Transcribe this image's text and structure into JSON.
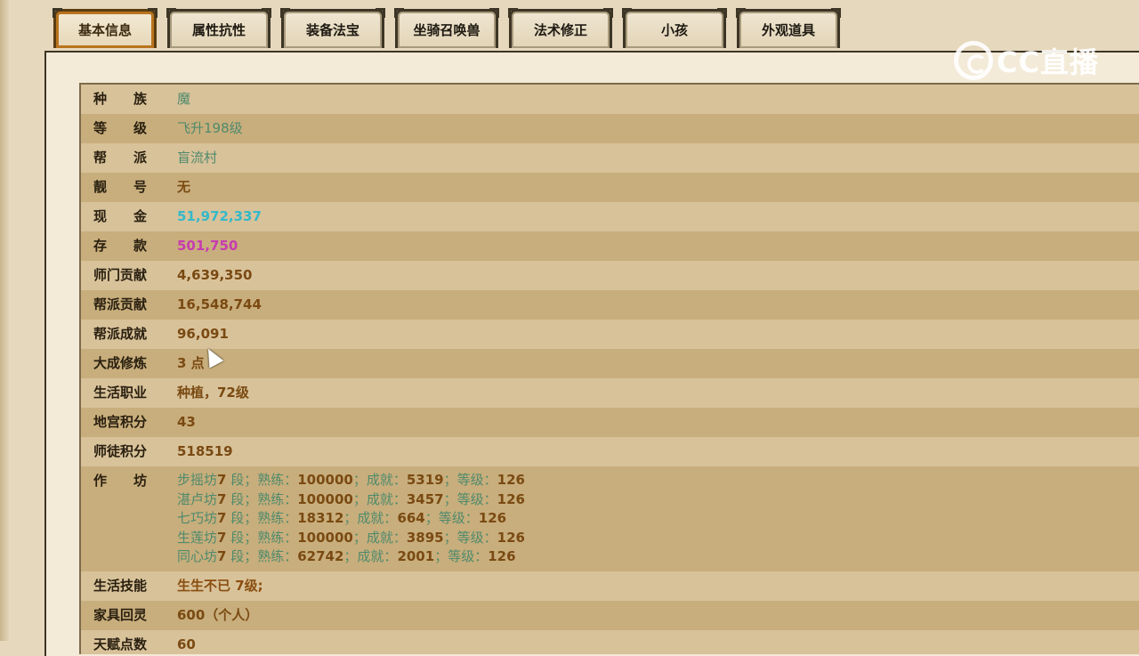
{
  "tabs": [
    {
      "label": "基本信息",
      "active": true
    },
    {
      "label": "属性抗性",
      "active": false
    },
    {
      "label": "装备法宝",
      "active": false
    },
    {
      "label": "坐骑召唤兽",
      "active": false
    },
    {
      "label": "法术修正",
      "active": false
    },
    {
      "label": "小孩",
      "active": false
    },
    {
      "label": "外观道具",
      "active": false
    }
  ],
  "logo": {
    "text": "CC直播",
    "icon": "cc-logo-icon"
  },
  "rows": [
    {
      "label": "种　　族",
      "value": "魔"
    },
    {
      "label": "等　　级",
      "value": "飞升198级"
    },
    {
      "label": "帮　　派",
      "value": "盲流村"
    },
    {
      "label": "靓　　号",
      "value": "无"
    },
    {
      "label": "现　　金",
      "value": "51,972,337"
    },
    {
      "label": "存　　款",
      "value": "501,750"
    },
    {
      "label": "师门贡献",
      "value": "4,639,350"
    },
    {
      "label": "帮派贡献",
      "value": "16,548,744"
    },
    {
      "label": "帮派成就",
      "value": "96,091"
    },
    {
      "label": "大成修炼",
      "value": "3 点"
    },
    {
      "label": "生活职业",
      "value": "种植，72级"
    },
    {
      "label": "地宫积分",
      "value": "43"
    },
    {
      "label": "师徒积分",
      "value": "518519"
    },
    {
      "label": "作　　坊",
      "value": ""
    },
    {
      "label": "生活技能",
      "value": "生生不已 7级;"
    },
    {
      "label": "家具回灵",
      "value": "600（个人）"
    },
    {
      "label": "天赋点数",
      "value": "60"
    }
  ],
  "workshops": [
    {
      "name": "步摇坊",
      "dan": "7",
      "shulian": "100000",
      "chengjiu": "5319",
      "dengji": "126"
    },
    {
      "name": "湛卢坊",
      "dan": "7",
      "shulian": "100000",
      "chengjiu": "3457",
      "dengji": "126"
    },
    {
      "name": "七巧坊",
      "dan": "7",
      "shulian": "18312",
      "chengjiu": "664",
      "dengji": "126"
    },
    {
      "name": "生莲坊",
      "dan": "7",
      "shulian": "100000",
      "chengjiu": "3895",
      "dengji": "126"
    },
    {
      "name": "同心坊",
      "dan": "7",
      "shulian": "62742",
      "chengjiu": "2001",
      "dengji": "126"
    }
  ],
  "workshop_text": {
    "duan": " 段；熟练：",
    "chengjiu": "；成就：",
    "dengji": "；等级："
  },
  "colors": {
    "green": "#4f8a6c",
    "cyan": "#34b9c9",
    "magenta": "#c83cb0",
    "brown": "#7a4a12"
  }
}
